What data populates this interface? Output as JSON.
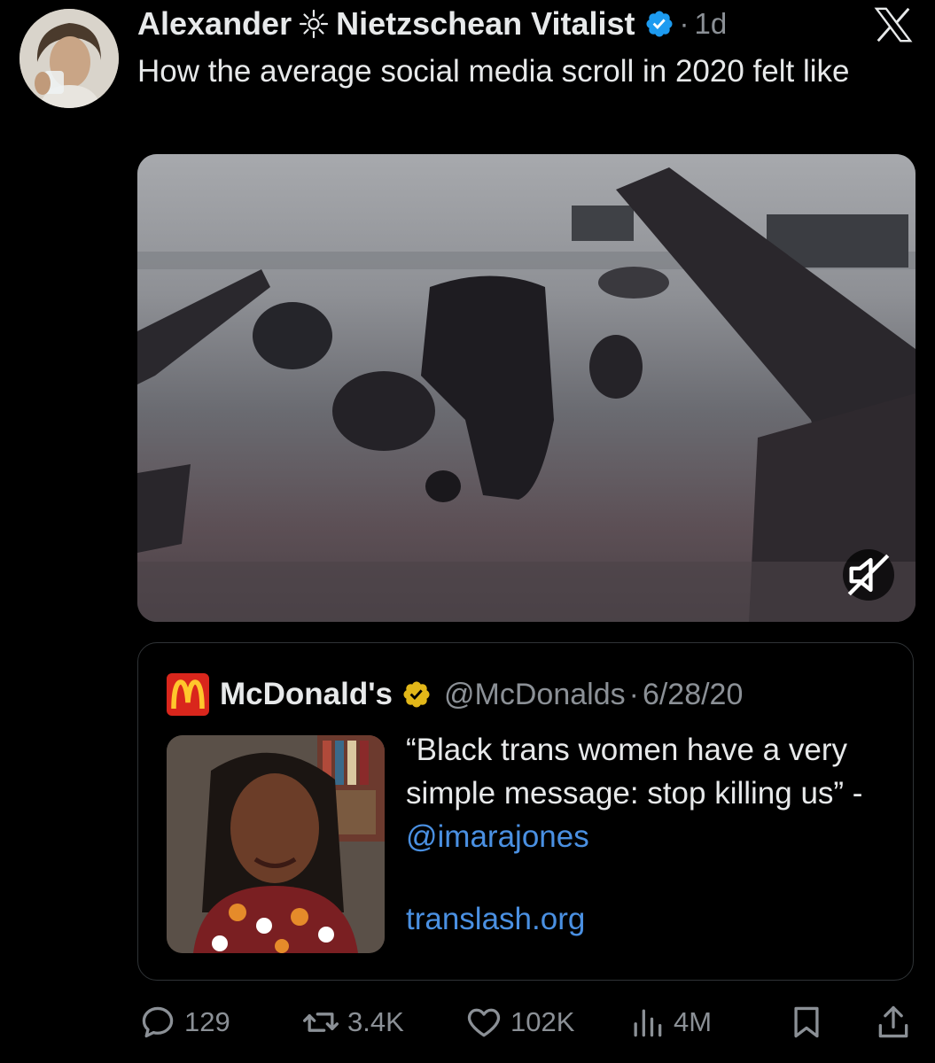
{
  "tweet": {
    "author_name": "Alexander",
    "author_name_suffix": "Nietzschean Vitalist",
    "separator": "·",
    "time": "1d",
    "text": "How the average social media scroll in 2020 felt like"
  },
  "media": {
    "icon": "mute-icon"
  },
  "quote": {
    "name": "McDonald's",
    "handle": "@McDonalds",
    "separator": "·",
    "date": "6/28/20",
    "text_before": "“Black trans women have a very simple message: stop killing us” - ",
    "mention": "@imarajones",
    "link": "translash.org"
  },
  "actions": {
    "replies": "129",
    "reposts": "3.4K",
    "likes": "102K",
    "views": "4M"
  },
  "colors": {
    "background": "#000000",
    "text": "#e7e9ea",
    "muted": "#8b9096",
    "link": "#4a90e2",
    "verified_blue": "#1d9bf0",
    "verified_gold": "#e2b719",
    "mcdonalds_red": "#d9261c"
  }
}
